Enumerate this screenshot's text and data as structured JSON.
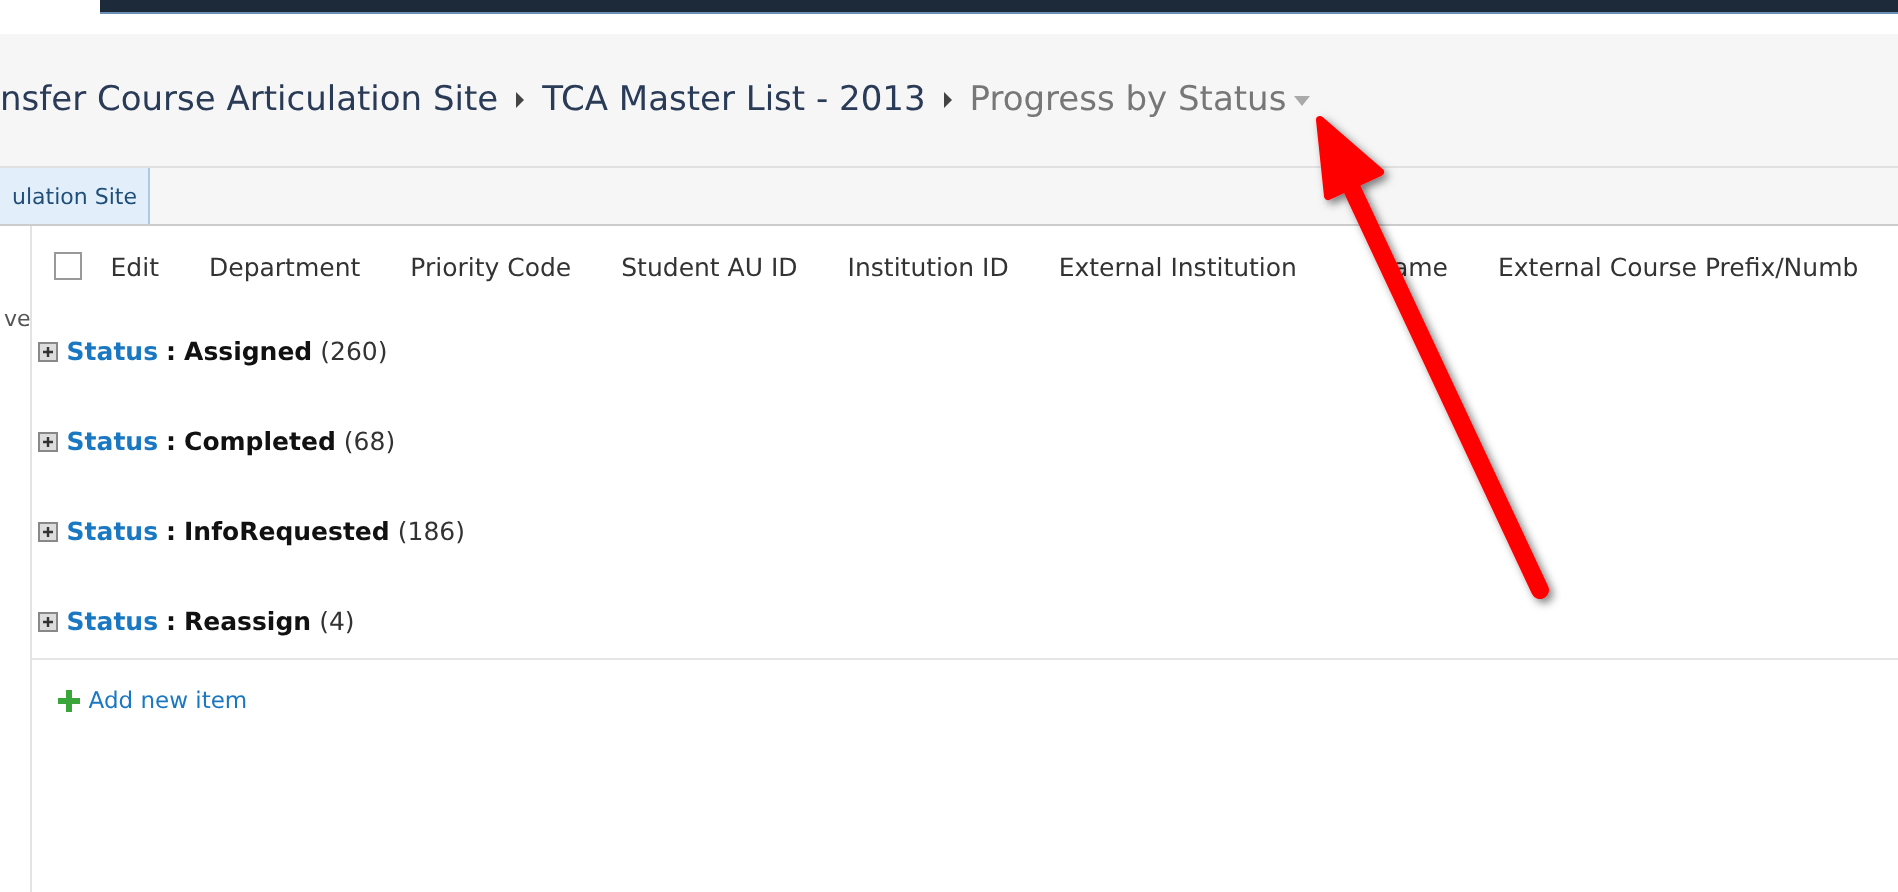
{
  "breadcrumb": {
    "site": "nsfer Course Articulation Site",
    "list": "TCA Master List - 2013",
    "view": "Progress by Status"
  },
  "tab": {
    "label": "ulation Site",
    "selected": true
  },
  "left_nav": {
    "text": "ve"
  },
  "table": {
    "columns": [
      {
        "label": "Edit"
      },
      {
        "label": "Department"
      },
      {
        "label": "Priority Code"
      },
      {
        "label": "Student AU ID"
      },
      {
        "label": "Institution ID"
      },
      {
        "label": "External Institution",
        "covered_tail": "ame"
      },
      {
        "label": "External Course Prefix/Numb"
      }
    ],
    "select_all": {
      "checked": false
    },
    "groups": [
      {
        "field": "Status",
        "separator": ":",
        "value": "Assigned",
        "count": "(260)",
        "expanded": false
      },
      {
        "field": "Status",
        "separator": ":",
        "value": "Completed",
        "count": "(68)",
        "expanded": false
      },
      {
        "field": "Status",
        "separator": ":",
        "value": "InfoRequested",
        "count": "(186)",
        "expanded": false
      },
      {
        "field": "Status",
        "separator": ":",
        "value": "Reassign",
        "count": "(4)",
        "expanded": false
      }
    ]
  },
  "add_item": "Add new item"
}
